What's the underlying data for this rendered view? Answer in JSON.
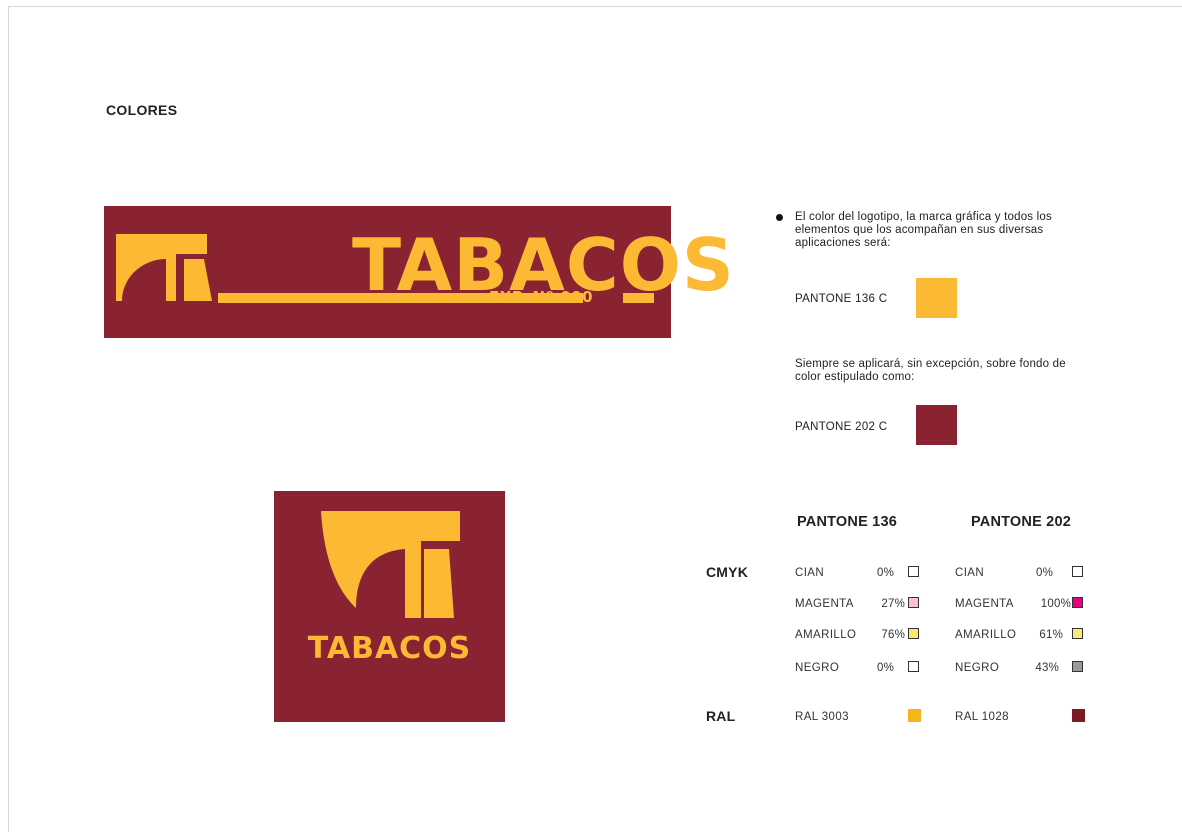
{
  "section_title": "COLORES",
  "colors": {
    "pantone_136": "#FBB934",
    "pantone_202": "#8A2331"
  },
  "logo_horizontal": {
    "word": "TABACOS",
    "exp": "EXP. Nº 000"
  },
  "logo_square": {
    "word": "TABACOS"
  },
  "intro": {
    "text": "El color del logotipo, la marca gráfica y todos los elementos que los acompañan en sus diversas aplicaciones será:",
    "pantone_label": "PANTONE 136 C"
  },
  "background": {
    "text": "Siempre se aplicará, sin excepción, sobre fondo de color estipulado como:",
    "pantone_label": "PANTONE 202 C"
  },
  "table": {
    "col_headers": [
      "PANTONE 136",
      "PANTONE 202"
    ],
    "cmyk_label": "CMYK",
    "ral_label": "RAL",
    "pantone_136_cmyk": [
      {
        "name": "CIAN",
        "pct": "0%",
        "color": "#FFFFFF"
      },
      {
        "name": "MAGENTA",
        "pct": "27%",
        "color": "#F7C4D3"
      },
      {
        "name": "AMARILLO",
        "pct": "76%",
        "color": "#FBEA6E"
      },
      {
        "name": "NEGRO",
        "pct": "0%",
        "color": "#FFFFFF"
      }
    ],
    "pantone_202_cmyk": [
      {
        "name": "CIAN",
        "pct": "0%",
        "color": "#FFFFFF"
      },
      {
        "name": "MAGENTA",
        "pct": "100%",
        "color": "#E6007E"
      },
      {
        "name": "AMARILLO",
        "pct": "61%",
        "color": "#FBEA7A"
      },
      {
        "name": "NEGRO",
        "pct": "43%",
        "color": "#9A9A9A"
      }
    ],
    "ral": [
      {
        "name": "RAL 3003",
        "color": "#F5B51B"
      },
      {
        "name": "RAL 1028",
        "color": "#7E1B22"
      }
    ]
  }
}
